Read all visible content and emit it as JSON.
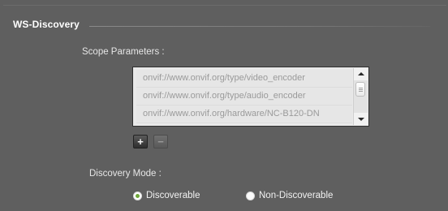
{
  "section": {
    "title": "WS-Discovery"
  },
  "scope": {
    "label": "Scope Parameters :",
    "items": [
      "onvif://www.onvif.org/type/video_encoder",
      "onvif://www.onvif.org/type/audio_encoder",
      "onvif://www.onvif.org/hardware/NC-B120-DN"
    ],
    "add_label": "+",
    "remove_label": "−"
  },
  "discovery": {
    "label": "Discovery Mode :",
    "options": [
      {
        "label": "Discoverable",
        "selected": true
      },
      {
        "label": "Non-Discoverable",
        "selected": false
      }
    ]
  },
  "colors": {
    "background": "#5f5f5f",
    "radio_selected": "#6fa83a"
  },
  "icons": {
    "scroll_up": "triangle-up-icon",
    "scroll_down": "triangle-down-icon"
  }
}
